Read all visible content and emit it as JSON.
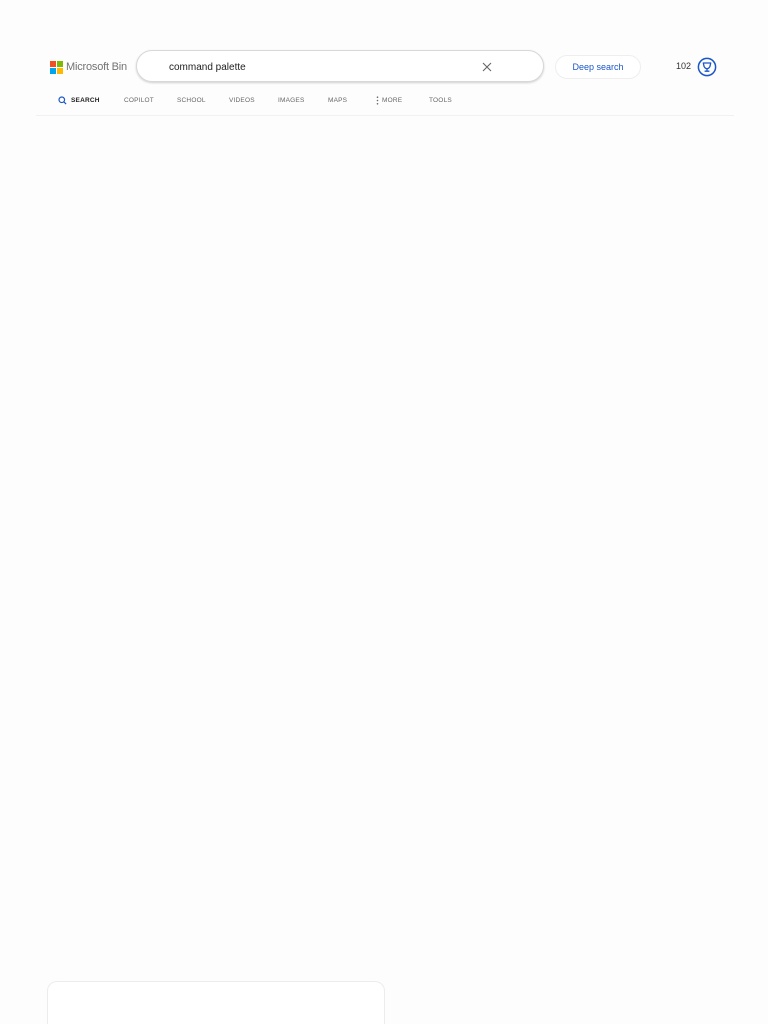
{
  "brand": {
    "logo_text": "Microsoft Bing",
    "logo_colors": [
      "#f25022",
      "#7fba00",
      "#00a4ef",
      "#ffb900"
    ]
  },
  "search": {
    "query": "command palette",
    "clear_icon": "close-icon"
  },
  "header": {
    "deep_search_label": "Deep search",
    "points": "102",
    "reward_icon": "rewards-trophy-icon",
    "accent_color": "#1a56c9"
  },
  "nav": {
    "items": [
      {
        "label": "SEARCH",
        "icon": "search-icon",
        "active": true
      },
      {
        "label": "COPILOT"
      },
      {
        "label": "SCHOOL"
      },
      {
        "label": "VIDEOS"
      },
      {
        "label": "IMAGES"
      },
      {
        "label": "MAPS"
      },
      {
        "label": "MORE",
        "icon": "more-vertical-icon"
      },
      {
        "label": "TOOLS"
      }
    ]
  }
}
